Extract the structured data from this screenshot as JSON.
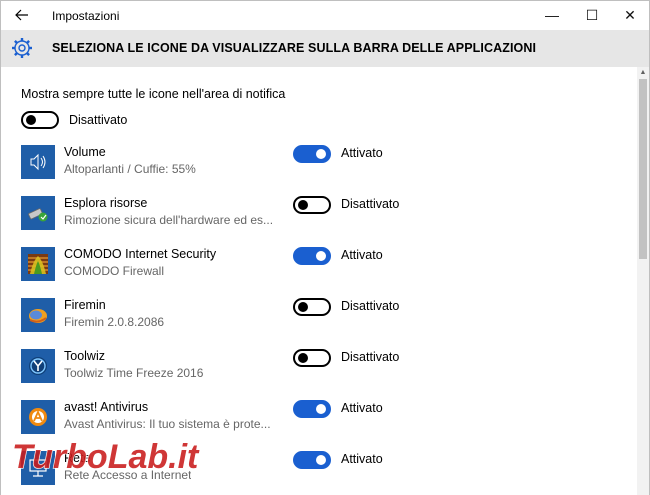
{
  "window": {
    "title": "Impostazioni",
    "back_icon": "back-arrow-icon",
    "minimize_glyph": "—",
    "maximize_glyph": "☐",
    "close_glyph": "✕"
  },
  "header": {
    "icon": "gear-icon",
    "title": "SELEZIONA LE ICONE DA VISUALIZZARE SULLA BARRA DELLE APPLICAZIONI"
  },
  "always_show": {
    "label": "Mostra sempre tutte le icone nell'area di notifica",
    "state_label": "Disattivato",
    "enabled": false
  },
  "items": [
    {
      "name": "Volume",
      "description": "Altoparlanti / Cuffie: 55%",
      "state_label": "Attivato",
      "enabled": true,
      "icon": "speaker-icon"
    },
    {
      "name": "Esplora risorse",
      "description": "Rimozione sicura dell'hardware ed es...",
      "state_label": "Disattivato",
      "enabled": false,
      "icon": "usb-eject-icon"
    },
    {
      "name": "COMODO Internet Security",
      "description": "COMODO Firewall",
      "state_label": "Attivato",
      "enabled": true,
      "icon": "comodo-firewall-icon"
    },
    {
      "name": "Firemin",
      "description": "Firemin 2.0.8.2086",
      "state_label": "Disattivato",
      "enabled": false,
      "icon": "firemin-icon"
    },
    {
      "name": "Toolwiz",
      "description": "Toolwiz Time Freeze 2016",
      "state_label": "Disattivato",
      "enabled": false,
      "icon": "toolwiz-icon"
    },
    {
      "name": "avast! Antivirus",
      "description": "Avast Antivirus: Il tuo sistema è prote...",
      "state_label": "Attivato",
      "enabled": true,
      "icon": "avast-icon"
    },
    {
      "name": "Rete",
      "description": "Rete Accesso a Internet",
      "state_label": "Attivato",
      "enabled": true,
      "icon": "network-icon"
    }
  ],
  "watermark": {
    "text_a": "Turbo",
    "text_b": "Lab",
    "text_c": ".it"
  },
  "colors": {
    "accent": "#1a5fd0",
    "icon_bg": "#1f5ea8",
    "header_bg": "#e6e6e6"
  }
}
